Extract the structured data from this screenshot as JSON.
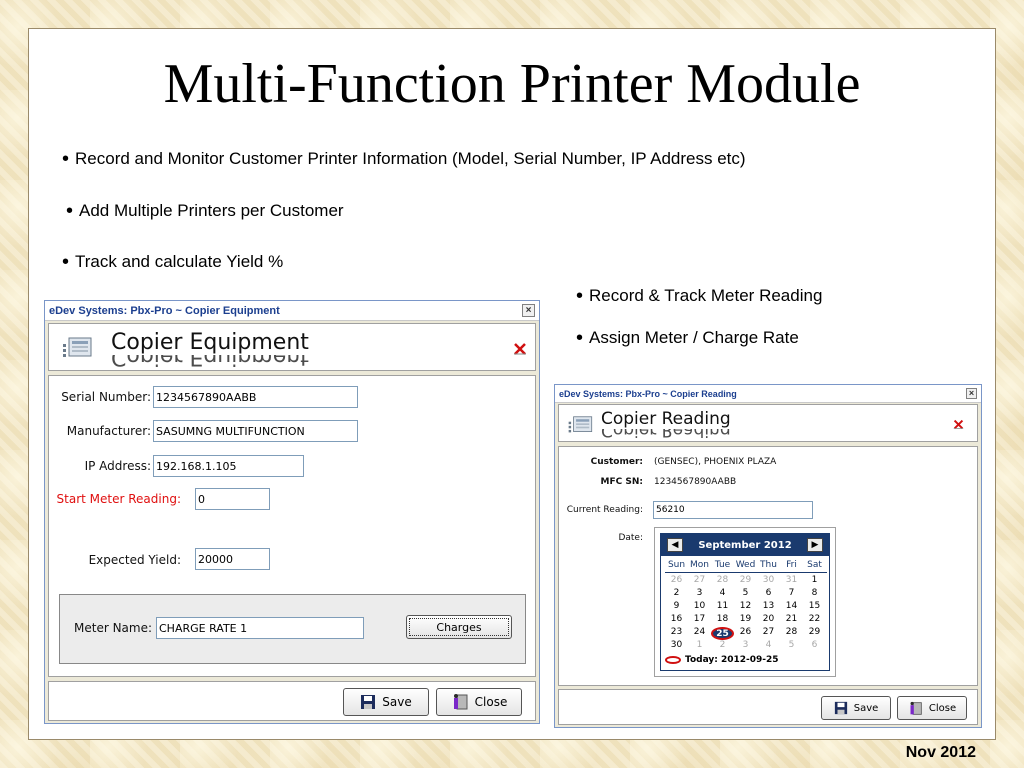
{
  "slide": {
    "title": "Multi-Function Printer Module",
    "bullets": [
      "Record and Monitor Customer Printer Information (Model, Serial Number, IP Address etc)",
      "Add Multiple Printers per Customer",
      "Track and calculate Yield %",
      "Record & Track Meter Reading",
      "Assign Meter / Charge Rate"
    ],
    "footer_date": "Nov 2012"
  },
  "equipment_window": {
    "titlebar": "eDev Systems: Pbx-Pro ~ Copier Equipment",
    "close_glyph": "×",
    "header_title": "Copier Equipment",
    "fields": {
      "serial_label": "Serial Number:",
      "serial_value": "1234567890AABB",
      "manufacturer_label": "Manufacturer:",
      "manufacturer_value": "SASUMNG MULTIFUNCTION",
      "ip_label": "IP Address:",
      "ip_value": "192.168.1.105",
      "start_meter_label": "Start Meter Reading:",
      "start_meter_value": "0",
      "yield_label": "Expected Yield:",
      "yield_value": "20000",
      "meter_name_label": "Meter Name:",
      "meter_name_value": "CHARGE RATE 1"
    },
    "charges_button": "Charges",
    "save_button": "Save",
    "close_button": "Close"
  },
  "reading_window": {
    "titlebar": "eDev Systems: Pbx-Pro ~ Copier Reading",
    "close_glyph": "×",
    "header_title": "Copier Reading",
    "customer_label": "Customer:",
    "customer_value": "(GENSEC), PHOENIX PLAZA",
    "mfc_label": "MFC SN:",
    "mfc_value": "1234567890AABB",
    "current_reading_label": "Current Reading:",
    "current_reading_value": "56210",
    "date_label": "Date:",
    "calendar": {
      "month": "September 2012",
      "prev": "◀",
      "next": "▶",
      "days_of_week": [
        "Sun",
        "Mon",
        "Tue",
        "Wed",
        "Thu",
        "Fri",
        "Sat"
      ],
      "weeks": [
        [
          "26",
          "27",
          "28",
          "29",
          "30",
          "31",
          "1"
        ],
        [
          "2",
          "3",
          "4",
          "5",
          "6",
          "7",
          "8"
        ],
        [
          "9",
          "10",
          "11",
          "12",
          "13",
          "14",
          "15"
        ],
        [
          "16",
          "17",
          "18",
          "19",
          "20",
          "21",
          "22"
        ],
        [
          "23",
          "24",
          "25",
          "26",
          "27",
          "28",
          "29"
        ],
        [
          "30",
          "1",
          "2",
          "3",
          "4",
          "5",
          "6"
        ]
      ],
      "today_label": "Today: 2012-09-25"
    },
    "save_button": "Save",
    "close_button": "Close"
  }
}
